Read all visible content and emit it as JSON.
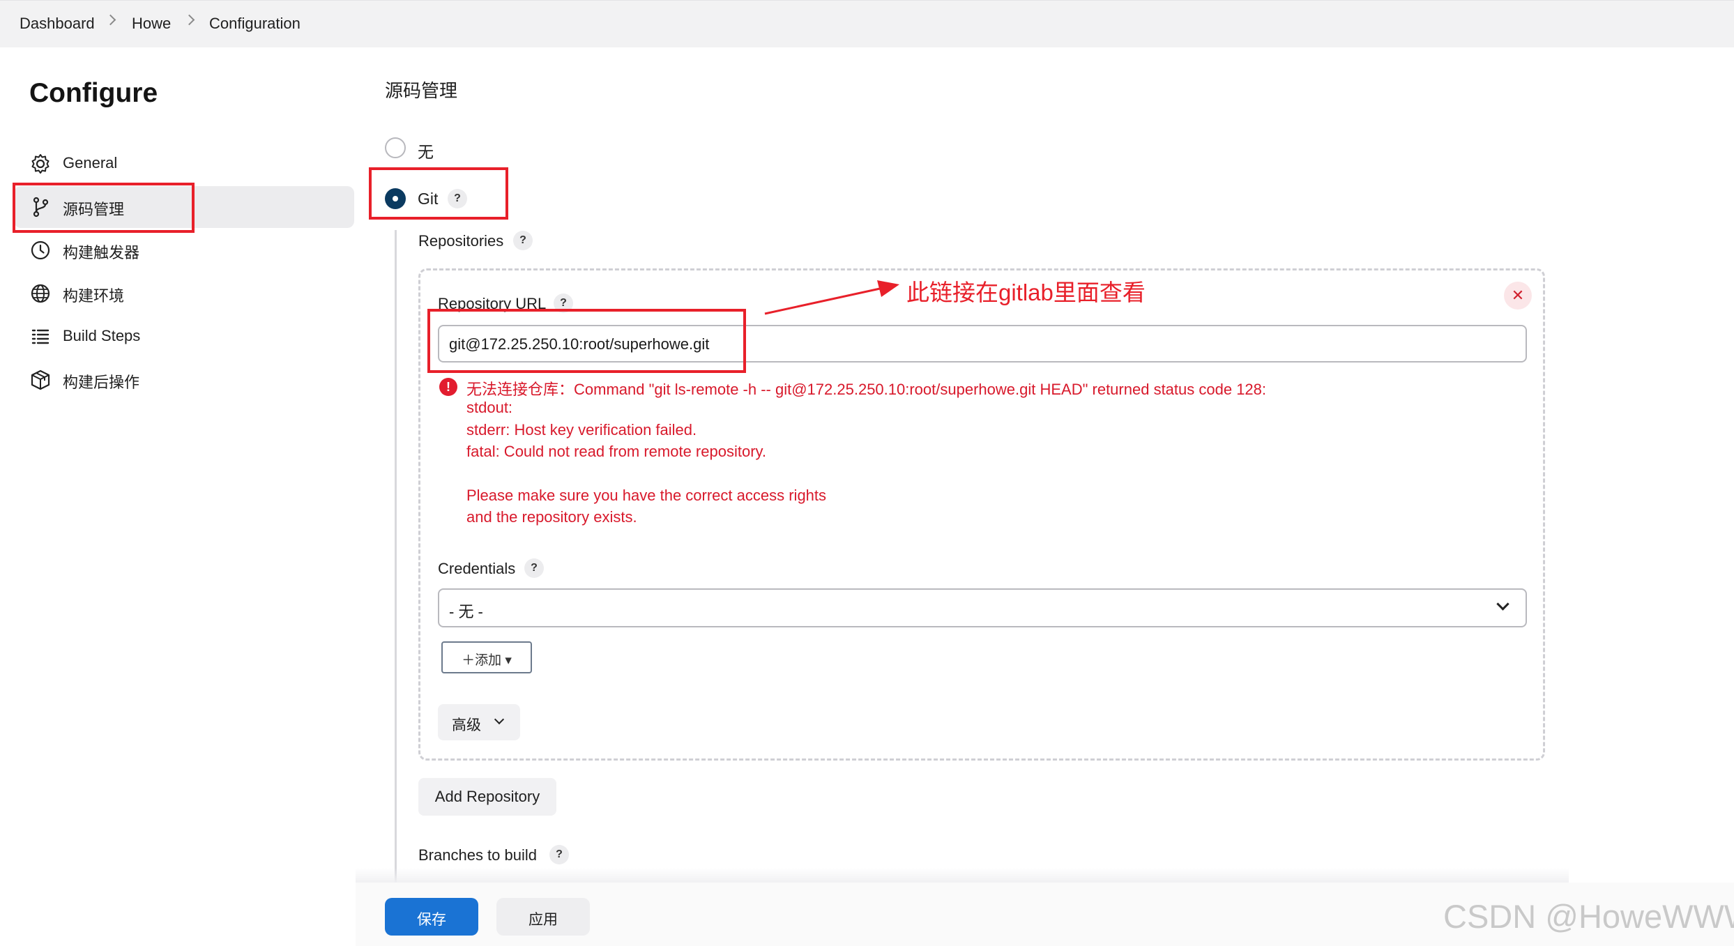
{
  "breadcrumb": [
    "Dashboard",
    "Howe",
    "Configuration"
  ],
  "sidebar": {
    "title": "Configure",
    "items": [
      {
        "label": "General",
        "icon": "gear-icon"
      },
      {
        "label": "源码管理",
        "icon": "git-branch-icon"
      },
      {
        "label": "构建触发器",
        "icon": "clock-icon"
      },
      {
        "label": "构建环境",
        "icon": "globe-icon"
      },
      {
        "label": "Build Steps",
        "icon": "list-icon"
      },
      {
        "label": "构建后操作",
        "icon": "package-icon"
      }
    ],
    "active_index": 1
  },
  "scm": {
    "title": "源码管理",
    "options": [
      {
        "label": "无",
        "selected": false
      },
      {
        "label": "Git",
        "selected": true
      }
    ],
    "help_glyph": "?"
  },
  "repositories": {
    "label": "Repositories",
    "close_glyph": "✕",
    "url_label": "Repository URL",
    "url_value": "git@172.25.250.10:root/superhowe.git",
    "error_icon": "!",
    "error_lines": [
      "无法连接仓库：Command \"git ls-remote -h -- git@172.25.250.10:root/superhowe.git HEAD\" returned status code 128:",
      "stdout:",
      "stderr: Host key verification failed.",
      "fatal: Could not read from remote repository.",
      "",
      "Please make sure you have the correct access rights",
      "and the repository exists."
    ],
    "credentials_label": "Credentials",
    "credentials_value": "- 无 -",
    "add_button": "＋添加 ▾",
    "advanced_button": "高级"
  },
  "add_repository_button": "Add Repository",
  "branches_label": "Branches to build",
  "footer": {
    "save": "保存",
    "apply": "应用"
  },
  "annotation": "此链接在gitlab里面查看",
  "watermark": "CSDN @HoweWWW",
  "colors": {
    "annotation_red": "#e8202a",
    "error_red": "#d8192b",
    "primary_blue": "#1a73d4",
    "radio_selected": "#0b3a60"
  }
}
